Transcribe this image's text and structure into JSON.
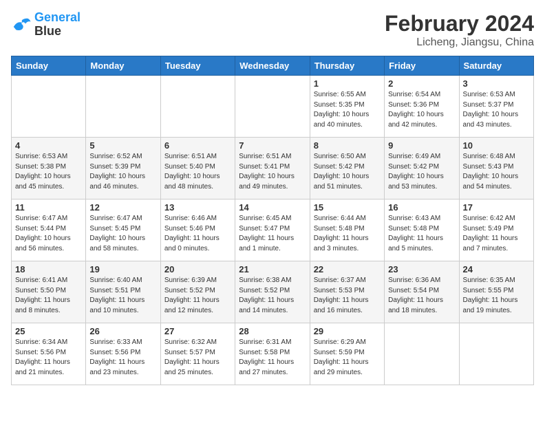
{
  "header": {
    "logo_line1": "General",
    "logo_line2": "Blue",
    "month": "February 2024",
    "location": "Licheng, Jiangsu, China"
  },
  "weekdays": [
    "Sunday",
    "Monday",
    "Tuesday",
    "Wednesday",
    "Thursday",
    "Friday",
    "Saturday"
  ],
  "weeks": [
    [
      {
        "day": "",
        "info": ""
      },
      {
        "day": "",
        "info": ""
      },
      {
        "day": "",
        "info": ""
      },
      {
        "day": "",
        "info": ""
      },
      {
        "day": "1",
        "info": "Sunrise: 6:55 AM\nSunset: 5:35 PM\nDaylight: 10 hours\nand 40 minutes."
      },
      {
        "day": "2",
        "info": "Sunrise: 6:54 AM\nSunset: 5:36 PM\nDaylight: 10 hours\nand 42 minutes."
      },
      {
        "day": "3",
        "info": "Sunrise: 6:53 AM\nSunset: 5:37 PM\nDaylight: 10 hours\nand 43 minutes."
      }
    ],
    [
      {
        "day": "4",
        "info": "Sunrise: 6:53 AM\nSunset: 5:38 PM\nDaylight: 10 hours\nand 45 minutes."
      },
      {
        "day": "5",
        "info": "Sunrise: 6:52 AM\nSunset: 5:39 PM\nDaylight: 10 hours\nand 46 minutes."
      },
      {
        "day": "6",
        "info": "Sunrise: 6:51 AM\nSunset: 5:40 PM\nDaylight: 10 hours\nand 48 minutes."
      },
      {
        "day": "7",
        "info": "Sunrise: 6:51 AM\nSunset: 5:41 PM\nDaylight: 10 hours\nand 49 minutes."
      },
      {
        "day": "8",
        "info": "Sunrise: 6:50 AM\nSunset: 5:42 PM\nDaylight: 10 hours\nand 51 minutes."
      },
      {
        "day": "9",
        "info": "Sunrise: 6:49 AM\nSunset: 5:42 PM\nDaylight: 10 hours\nand 53 minutes."
      },
      {
        "day": "10",
        "info": "Sunrise: 6:48 AM\nSunset: 5:43 PM\nDaylight: 10 hours\nand 54 minutes."
      }
    ],
    [
      {
        "day": "11",
        "info": "Sunrise: 6:47 AM\nSunset: 5:44 PM\nDaylight: 10 hours\nand 56 minutes."
      },
      {
        "day": "12",
        "info": "Sunrise: 6:47 AM\nSunset: 5:45 PM\nDaylight: 10 hours\nand 58 minutes."
      },
      {
        "day": "13",
        "info": "Sunrise: 6:46 AM\nSunset: 5:46 PM\nDaylight: 11 hours\nand 0 minutes."
      },
      {
        "day": "14",
        "info": "Sunrise: 6:45 AM\nSunset: 5:47 PM\nDaylight: 11 hours\nand 1 minute."
      },
      {
        "day": "15",
        "info": "Sunrise: 6:44 AM\nSunset: 5:48 PM\nDaylight: 11 hours\nand 3 minutes."
      },
      {
        "day": "16",
        "info": "Sunrise: 6:43 AM\nSunset: 5:48 PM\nDaylight: 11 hours\nand 5 minutes."
      },
      {
        "day": "17",
        "info": "Sunrise: 6:42 AM\nSunset: 5:49 PM\nDaylight: 11 hours\nand 7 minutes."
      }
    ],
    [
      {
        "day": "18",
        "info": "Sunrise: 6:41 AM\nSunset: 5:50 PM\nDaylight: 11 hours\nand 8 minutes."
      },
      {
        "day": "19",
        "info": "Sunrise: 6:40 AM\nSunset: 5:51 PM\nDaylight: 11 hours\nand 10 minutes."
      },
      {
        "day": "20",
        "info": "Sunrise: 6:39 AM\nSunset: 5:52 PM\nDaylight: 11 hours\nand 12 minutes."
      },
      {
        "day": "21",
        "info": "Sunrise: 6:38 AM\nSunset: 5:52 PM\nDaylight: 11 hours\nand 14 minutes."
      },
      {
        "day": "22",
        "info": "Sunrise: 6:37 AM\nSunset: 5:53 PM\nDaylight: 11 hours\nand 16 minutes."
      },
      {
        "day": "23",
        "info": "Sunrise: 6:36 AM\nSunset: 5:54 PM\nDaylight: 11 hours\nand 18 minutes."
      },
      {
        "day": "24",
        "info": "Sunrise: 6:35 AM\nSunset: 5:55 PM\nDaylight: 11 hours\nand 19 minutes."
      }
    ],
    [
      {
        "day": "25",
        "info": "Sunrise: 6:34 AM\nSunset: 5:56 PM\nDaylight: 11 hours\nand 21 minutes."
      },
      {
        "day": "26",
        "info": "Sunrise: 6:33 AM\nSunset: 5:56 PM\nDaylight: 11 hours\nand 23 minutes."
      },
      {
        "day": "27",
        "info": "Sunrise: 6:32 AM\nSunset: 5:57 PM\nDaylight: 11 hours\nand 25 minutes."
      },
      {
        "day": "28",
        "info": "Sunrise: 6:31 AM\nSunset: 5:58 PM\nDaylight: 11 hours\nand 27 minutes."
      },
      {
        "day": "29",
        "info": "Sunrise: 6:29 AM\nSunset: 5:59 PM\nDaylight: 11 hours\nand 29 minutes."
      },
      {
        "day": "",
        "info": ""
      },
      {
        "day": "",
        "info": ""
      }
    ]
  ]
}
